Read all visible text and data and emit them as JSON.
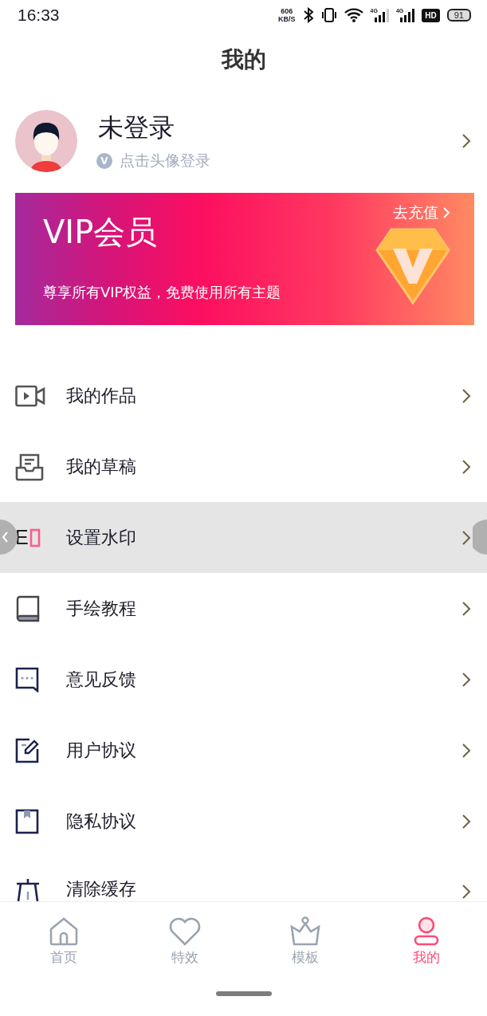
{
  "status_bar": {
    "time": "16:33",
    "speed_value": "606",
    "speed_unit": "KB/S",
    "sim_labels": [
      "4G",
      "4G"
    ],
    "hd_label": "HD",
    "battery": "91"
  },
  "header": {
    "title": "我的"
  },
  "profile": {
    "name": "未登录",
    "hint": "点击头像登录",
    "badge": "V"
  },
  "vip_card": {
    "title": "VIP会员",
    "subtitle": "尊享所有VIP权益，免费使用所有主题",
    "action": "去充值"
  },
  "menu": [
    {
      "kind": "video",
      "label": "我的作品",
      "selected": false
    },
    {
      "kind": "drafts",
      "label": "我的草稿",
      "selected": false
    },
    {
      "kind": "watermark",
      "label": "设置水印",
      "glyph": "E",
      "selected": true
    },
    {
      "kind": "book",
      "label": "手绘教程",
      "selected": false
    },
    {
      "kind": "feedback",
      "label": "意见反馈",
      "selected": false
    },
    {
      "kind": "agreement",
      "label": "用户协议",
      "selected": false
    },
    {
      "kind": "privacy",
      "label": "隐私协议",
      "selected": false
    },
    {
      "kind": "clear",
      "label": "清除缓存",
      "selected": false
    }
  ],
  "bottom_nav": [
    {
      "kind": "home",
      "label": "首页",
      "selected": false
    },
    {
      "kind": "heart",
      "label": "特效",
      "selected": false
    },
    {
      "kind": "crown",
      "label": "模板",
      "selected": false
    },
    {
      "kind": "person",
      "label": "我的",
      "selected": true
    }
  ]
}
